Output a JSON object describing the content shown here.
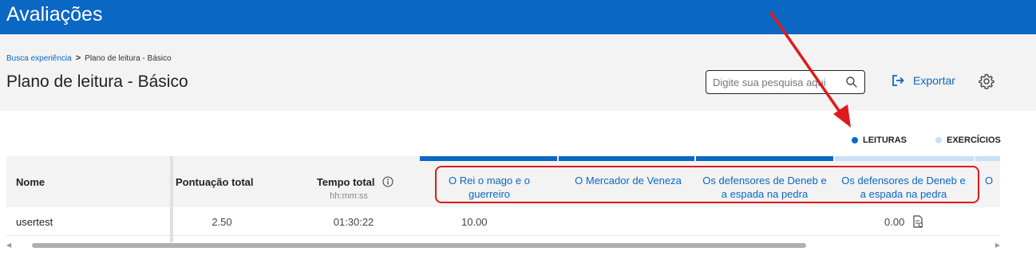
{
  "app": {
    "title": "Avaliações"
  },
  "breadcrumb": {
    "link": "Busca experiência",
    "separator": ">",
    "current": "Plano de leitura - Básico"
  },
  "page": {
    "title": "Plano de leitura - Básico"
  },
  "search": {
    "placeholder": "Digite sua pesquisa aqui",
    "value": ""
  },
  "toolbar": {
    "export_label": "Exportar"
  },
  "legend": {
    "items": [
      {
        "label": "LEITURAS",
        "color": "#0a67c4"
      },
      {
        "label": "EXERCÍCIOS",
        "color": "#c7e0f7"
      }
    ]
  },
  "table": {
    "columns": {
      "name": "Nome",
      "score": "Pontuação total",
      "time": "Tempo total",
      "time_sub": "hh:mm:ss"
    },
    "books": [
      {
        "line1": "O Rei o mago e o",
        "line2": "guerreiro",
        "bar_color": "#0a67c4"
      },
      {
        "line1": "O Mercador de Veneza",
        "line2": "",
        "bar_color": "#0a67c4"
      },
      {
        "line1": "Os defensores de Deneb e",
        "line2": "a espada na pedra",
        "bar_color": "#0a67c4"
      },
      {
        "line1": "Os defensores de Deneb e",
        "line2": "a espada na pedra",
        "bar_color": "#c7e0f7"
      },
      {
        "line1": "O",
        "line2": "",
        "bar_color": "#c7e0f7"
      }
    ],
    "rows": [
      {
        "name": "usertest",
        "score": "2.50",
        "time": "01:30:22",
        "book1": "10.00",
        "book4": "0.00"
      }
    ]
  },
  "colors": {
    "brand": "#0a67c4",
    "annotation": "#e01a1a"
  }
}
